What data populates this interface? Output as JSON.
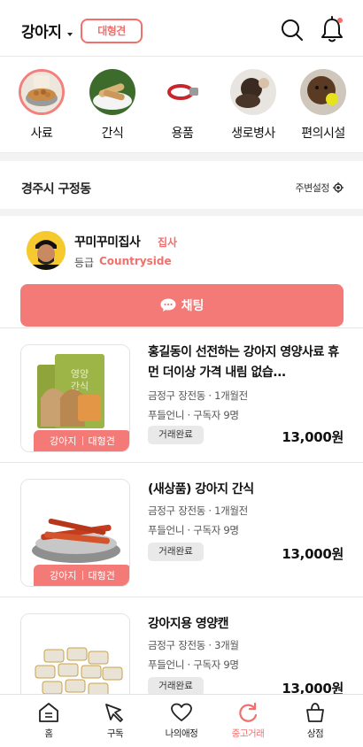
{
  "header": {
    "pet_type": "강아지",
    "size_badge": "대형견"
  },
  "categories": [
    {
      "label": "사료",
      "icon": "dog-food-bowl",
      "active": true
    },
    {
      "label": "간식",
      "icon": "dog-treats"
    },
    {
      "label": "용품",
      "icon": "dog-collar"
    },
    {
      "label": "생로병사",
      "icon": "dog-photo"
    },
    {
      "label": "편의시설",
      "icon": "dog-with-ball"
    }
  ],
  "location": {
    "name": "경주시 구정동",
    "nearby_setting": "주변설정"
  },
  "profile": {
    "nickname": "꾸미꾸미집사",
    "role": "집사",
    "grade_label": "등급",
    "grade_value": "Countryside",
    "chat_button": "채팅"
  },
  "products": [
    {
      "title": "홍길동이 선전하는 강아지 영양사료 휴먼 더이상 가격 내림 없습...",
      "meta1": "금정구 장전동 · 1개월전",
      "meta2": "푸들언니 · 구독자 9명",
      "status": "거래완료",
      "price": "13,000원",
      "tags": [
        "강아지",
        "대형견"
      ]
    },
    {
      "title": "(새상품) 강아지 간식",
      "meta1": "금정구 장전동 · 1개월전",
      "meta2": "푸들언니 · 구독자 9명",
      "status": "거래완료",
      "price": "13,000원",
      "tags": [
        "강아지",
        "대형견"
      ]
    },
    {
      "title": "강아지용 영양캔",
      "meta1": "금정구 장전동 · 3개월",
      "meta2": "푸들언니 · 구독자 9명",
      "status": "거래완료",
      "price": "13,000원"
    }
  ],
  "tabbar": [
    {
      "label": "홈",
      "icon": "home-icon"
    },
    {
      "label": "구독",
      "icon": "subscribe-icon"
    },
    {
      "label": "나의애정",
      "icon": "heart-icon"
    },
    {
      "label": "중고거래",
      "icon": "refresh-icon",
      "active": true
    },
    {
      "label": "상점",
      "icon": "shopping-bag-icon"
    }
  ],
  "colors": {
    "accent": "#f47a77",
    "accent_text": "#f26f6c",
    "divider": "#f3f3f3"
  }
}
